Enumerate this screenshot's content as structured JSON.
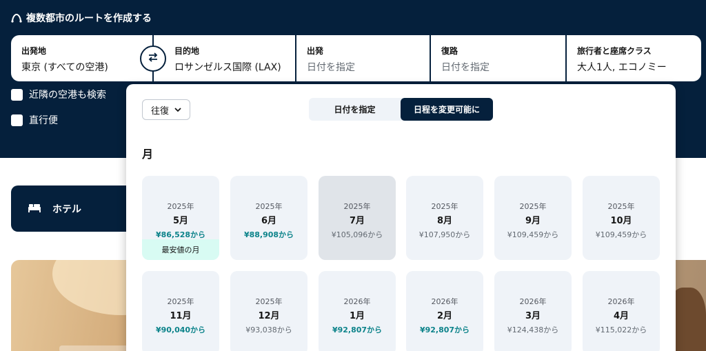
{
  "header": {
    "multicity_link": "複数都市のルートを作成する",
    "multicity_icon": "route-icon"
  },
  "search": {
    "origin": {
      "label": "出発地",
      "value": "東京 (すべての空港)"
    },
    "destination": {
      "label": "目的地",
      "value": "ロサンゼルス国際 (LAX)"
    },
    "depart": {
      "label": "出発",
      "placeholder": "日付を指定"
    },
    "return": {
      "label": "復路",
      "placeholder": "日付を指定"
    },
    "travellers": {
      "label": "旅行者と座席クラス",
      "value": "大人1人, エコノミー"
    },
    "swap_icon": "swap-arrows-icon"
  },
  "options": {
    "nearby_airports": "近隣の空港も検索",
    "direct_flights": "直行便"
  },
  "hotel_card": {
    "label": "ホテル",
    "icon": "bed-icon"
  },
  "date_popup": {
    "trip_type": "往復",
    "toggle": {
      "specific": "日付を指定",
      "flexible": "日程を変更可能に",
      "active": "flexible"
    },
    "section_title": "月",
    "months": [
      {
        "year": "2025年",
        "month": "5月",
        "price": "¥86,528から",
        "cheapest": true,
        "badge": "最安値の月"
      },
      {
        "year": "2025年",
        "month": "6月",
        "price": "¥88,908から",
        "cheapest": true
      },
      {
        "year": "2025年",
        "month": "7月",
        "price": "¥105,096から",
        "cheapest": false,
        "selected": true
      },
      {
        "year": "2025年",
        "month": "8月",
        "price": "¥107,950から",
        "cheapest": false
      },
      {
        "year": "2025年",
        "month": "9月",
        "price": "¥109,459から",
        "cheapest": false
      },
      {
        "year": "2025年",
        "month": "10月",
        "price": "¥109,459から",
        "cheapest": false
      },
      {
        "year": "2025年",
        "month": "11月",
        "price": "¥90,040から",
        "cheapest": true
      },
      {
        "year": "2025年",
        "month": "12月",
        "price": "¥93,038から",
        "cheapest": false
      },
      {
        "year": "2026年",
        "month": "1月",
        "price": "¥92,807から",
        "cheapest": true
      },
      {
        "year": "2026年",
        "month": "2月",
        "price": "¥92,807から",
        "cheapest": true
      },
      {
        "year": "2026年",
        "month": "3月",
        "price": "¥124,438から",
        "cheapest": false
      },
      {
        "year": "2026年",
        "month": "4月",
        "price": "¥115,022から",
        "cheapest": false
      }
    ]
  },
  "colors": {
    "navy": "#05203c",
    "teal_price": "#0c838a",
    "badge_bg": "#d8fbf3",
    "card_bg": "#eff3f8"
  }
}
